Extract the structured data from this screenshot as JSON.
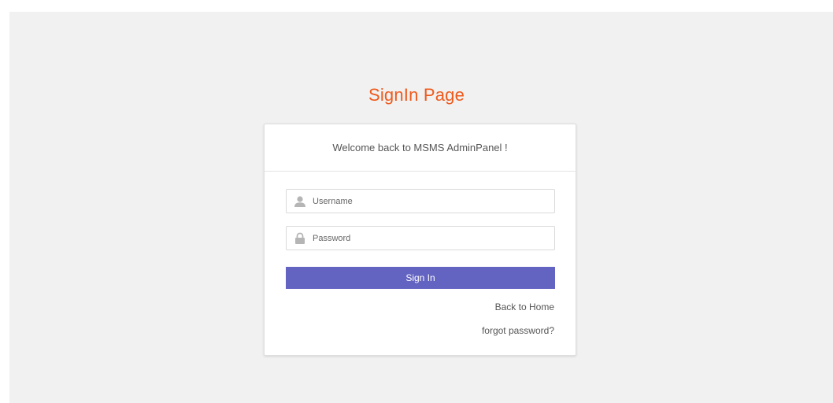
{
  "page": {
    "title": "SignIn Page"
  },
  "card": {
    "welcome": "Welcome back to MSMS AdminPanel !"
  },
  "form": {
    "username": {
      "placeholder": "Username",
      "value": "",
      "icon": "user-icon"
    },
    "password": {
      "placeholder": "Password",
      "value": "",
      "icon": "lock-icon"
    },
    "submit_label": "Sign In"
  },
  "links": {
    "back_home": "Back to Home",
    "forgot_password": "forgot password?"
  },
  "colors": {
    "title": "#ef5a1c",
    "button": "#6363c2",
    "background": "#f1f1f1"
  }
}
